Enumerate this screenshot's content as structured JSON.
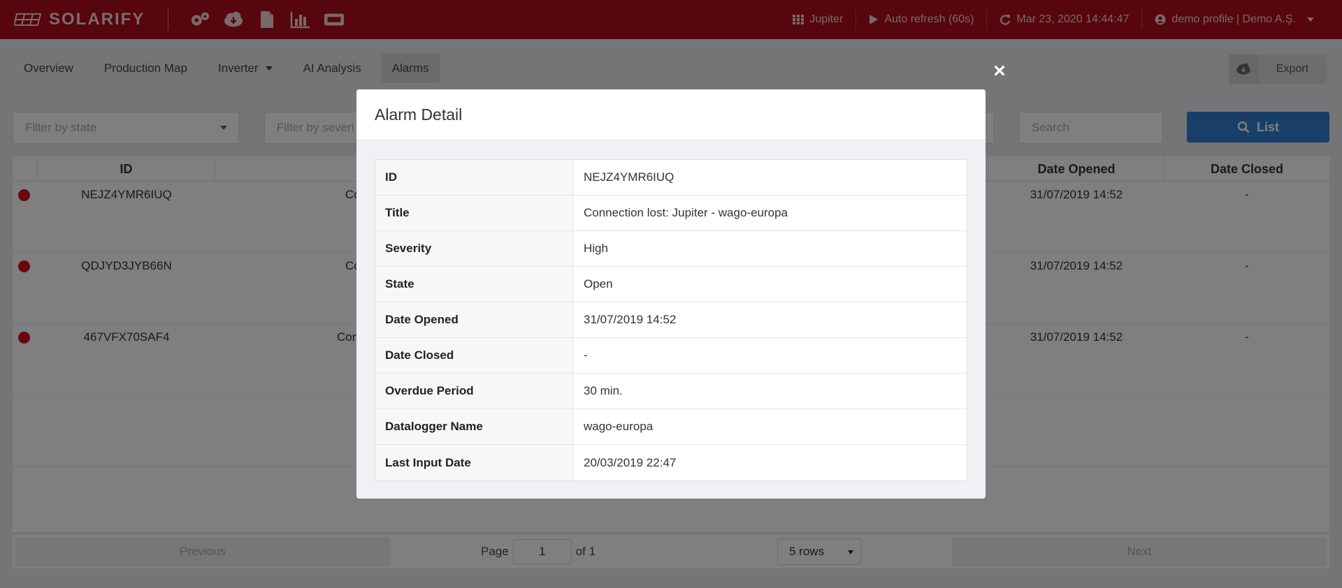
{
  "app": {
    "brand": "SOLARIFY"
  },
  "toolbar": {
    "icons": [
      "gears-icon",
      "cloud-download-icon",
      "file-icon",
      "bar-chart-icon",
      "ticket-icon"
    ]
  },
  "topbar": {
    "plant": "Jupiter",
    "auto_refresh": "Auto refresh (60s)",
    "datetime": "Mar 23, 2020 14:44:47",
    "profile": "demo profile | Demo A.Ş."
  },
  "tabs": [
    {
      "label": "Overview"
    },
    {
      "label": "Production Map"
    },
    {
      "label": "Inverter"
    },
    {
      "label": "AI Analysis"
    },
    {
      "label": "Alarms"
    }
  ],
  "export_label": "Export",
  "filters": {
    "state_placeholder": "Filter by state",
    "severity_placeholder": "Filter by severi",
    "search_placeholder": "Search"
  },
  "list_label": "List",
  "table": {
    "headers": {
      "id": "ID",
      "date_opened": "Date Opened",
      "date_closed": "Date Closed"
    },
    "rows": [
      {
        "id": "NEJZ4YMR6IUQ",
        "title_fragment": "Co",
        "date_opened": "31/07/2019 14:52",
        "date_closed": "-"
      },
      {
        "id": "QDJYD3JYB66N",
        "title_fragment": "Co",
        "date_opened": "31/07/2019 14:52",
        "date_closed": "-"
      },
      {
        "id": "467VFX70SAF4",
        "title_fragment": "Con",
        "date_opened": "31/07/2019 14:52",
        "date_closed": "-"
      }
    ]
  },
  "pagination": {
    "previous": "Previous",
    "page_label": "Page",
    "page_value": "1",
    "of_label": "of 1",
    "rows_select": "5 rows",
    "next": "Next"
  },
  "modal": {
    "close_glyph": "×",
    "title": "Alarm Detail",
    "rows": [
      {
        "label": "ID",
        "value": "NEJZ4YMR6IUQ"
      },
      {
        "label": "Title",
        "value": "Connection lost: Jupiter - wago-europa"
      },
      {
        "label": "Severity",
        "value": "High"
      },
      {
        "label": "State",
        "value": "Open"
      },
      {
        "label": "Date Opened",
        "value": "31/07/2019 14:52"
      },
      {
        "label": "Date Closed",
        "value": "-"
      },
      {
        "label": "Overdue Period",
        "value": "30 min."
      },
      {
        "label": "Datalogger Name",
        "value": "wago-europa"
      },
      {
        "label": "Last Input Date",
        "value": "20/03/2019 22:47"
      }
    ]
  },
  "colors": {
    "brand_red": "#ac0d18",
    "alarm_dot": "#d0101c",
    "list_button": "#2f7fd3"
  }
}
